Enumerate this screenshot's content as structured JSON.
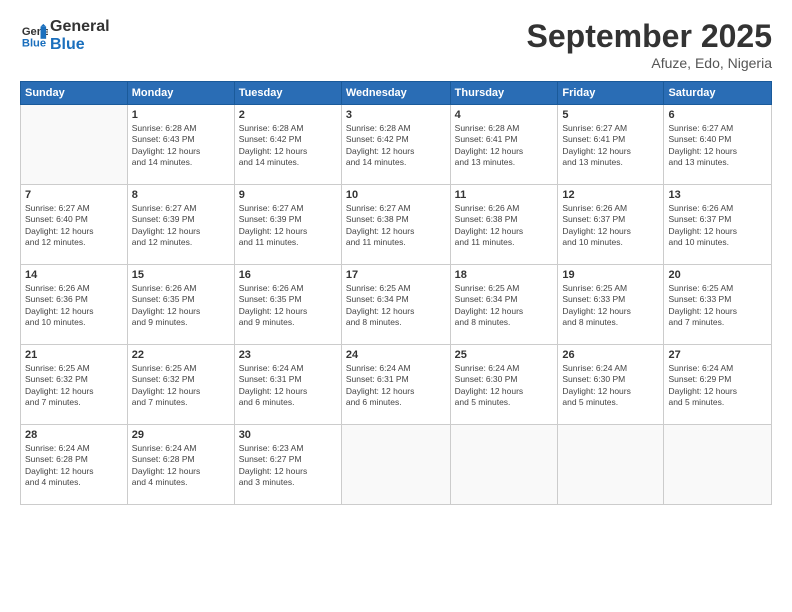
{
  "header": {
    "logo_line1": "General",
    "logo_line2": "Blue",
    "month": "September 2025",
    "location": "Afuze, Edo, Nigeria"
  },
  "days_of_week": [
    "Sunday",
    "Monday",
    "Tuesday",
    "Wednesday",
    "Thursday",
    "Friday",
    "Saturday"
  ],
  "weeks": [
    [
      {
        "num": "",
        "info": ""
      },
      {
        "num": "1",
        "info": "Sunrise: 6:28 AM\nSunset: 6:43 PM\nDaylight: 12 hours\nand 14 minutes."
      },
      {
        "num": "2",
        "info": "Sunrise: 6:28 AM\nSunset: 6:42 PM\nDaylight: 12 hours\nand 14 minutes."
      },
      {
        "num": "3",
        "info": "Sunrise: 6:28 AM\nSunset: 6:42 PM\nDaylight: 12 hours\nand 14 minutes."
      },
      {
        "num": "4",
        "info": "Sunrise: 6:28 AM\nSunset: 6:41 PM\nDaylight: 12 hours\nand 13 minutes."
      },
      {
        "num": "5",
        "info": "Sunrise: 6:27 AM\nSunset: 6:41 PM\nDaylight: 12 hours\nand 13 minutes."
      },
      {
        "num": "6",
        "info": "Sunrise: 6:27 AM\nSunset: 6:40 PM\nDaylight: 12 hours\nand 13 minutes."
      }
    ],
    [
      {
        "num": "7",
        "info": "Sunrise: 6:27 AM\nSunset: 6:40 PM\nDaylight: 12 hours\nand 12 minutes."
      },
      {
        "num": "8",
        "info": "Sunrise: 6:27 AM\nSunset: 6:39 PM\nDaylight: 12 hours\nand 12 minutes."
      },
      {
        "num": "9",
        "info": "Sunrise: 6:27 AM\nSunset: 6:39 PM\nDaylight: 12 hours\nand 11 minutes."
      },
      {
        "num": "10",
        "info": "Sunrise: 6:27 AM\nSunset: 6:38 PM\nDaylight: 12 hours\nand 11 minutes."
      },
      {
        "num": "11",
        "info": "Sunrise: 6:26 AM\nSunset: 6:38 PM\nDaylight: 12 hours\nand 11 minutes."
      },
      {
        "num": "12",
        "info": "Sunrise: 6:26 AM\nSunset: 6:37 PM\nDaylight: 12 hours\nand 10 minutes."
      },
      {
        "num": "13",
        "info": "Sunrise: 6:26 AM\nSunset: 6:37 PM\nDaylight: 12 hours\nand 10 minutes."
      }
    ],
    [
      {
        "num": "14",
        "info": "Sunrise: 6:26 AM\nSunset: 6:36 PM\nDaylight: 12 hours\nand 10 minutes."
      },
      {
        "num": "15",
        "info": "Sunrise: 6:26 AM\nSunset: 6:35 PM\nDaylight: 12 hours\nand 9 minutes."
      },
      {
        "num": "16",
        "info": "Sunrise: 6:26 AM\nSunset: 6:35 PM\nDaylight: 12 hours\nand 9 minutes."
      },
      {
        "num": "17",
        "info": "Sunrise: 6:25 AM\nSunset: 6:34 PM\nDaylight: 12 hours\nand 8 minutes."
      },
      {
        "num": "18",
        "info": "Sunrise: 6:25 AM\nSunset: 6:34 PM\nDaylight: 12 hours\nand 8 minutes."
      },
      {
        "num": "19",
        "info": "Sunrise: 6:25 AM\nSunset: 6:33 PM\nDaylight: 12 hours\nand 8 minutes."
      },
      {
        "num": "20",
        "info": "Sunrise: 6:25 AM\nSunset: 6:33 PM\nDaylight: 12 hours\nand 7 minutes."
      }
    ],
    [
      {
        "num": "21",
        "info": "Sunrise: 6:25 AM\nSunset: 6:32 PM\nDaylight: 12 hours\nand 7 minutes."
      },
      {
        "num": "22",
        "info": "Sunrise: 6:25 AM\nSunset: 6:32 PM\nDaylight: 12 hours\nand 7 minutes."
      },
      {
        "num": "23",
        "info": "Sunrise: 6:24 AM\nSunset: 6:31 PM\nDaylight: 12 hours\nand 6 minutes."
      },
      {
        "num": "24",
        "info": "Sunrise: 6:24 AM\nSunset: 6:31 PM\nDaylight: 12 hours\nand 6 minutes."
      },
      {
        "num": "25",
        "info": "Sunrise: 6:24 AM\nSunset: 6:30 PM\nDaylight: 12 hours\nand 5 minutes."
      },
      {
        "num": "26",
        "info": "Sunrise: 6:24 AM\nSunset: 6:30 PM\nDaylight: 12 hours\nand 5 minutes."
      },
      {
        "num": "27",
        "info": "Sunrise: 6:24 AM\nSunset: 6:29 PM\nDaylight: 12 hours\nand 5 minutes."
      }
    ],
    [
      {
        "num": "28",
        "info": "Sunrise: 6:24 AM\nSunset: 6:28 PM\nDaylight: 12 hours\nand 4 minutes."
      },
      {
        "num": "29",
        "info": "Sunrise: 6:24 AM\nSunset: 6:28 PM\nDaylight: 12 hours\nand 4 minutes."
      },
      {
        "num": "30",
        "info": "Sunrise: 6:23 AM\nSunset: 6:27 PM\nDaylight: 12 hours\nand 3 minutes."
      },
      {
        "num": "",
        "info": ""
      },
      {
        "num": "",
        "info": ""
      },
      {
        "num": "",
        "info": ""
      },
      {
        "num": "",
        "info": ""
      }
    ]
  ]
}
